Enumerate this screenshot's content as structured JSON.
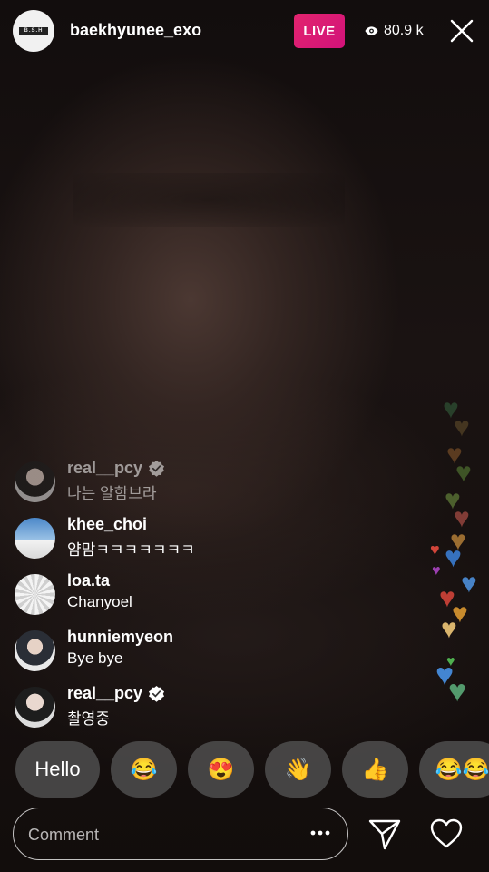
{
  "header": {
    "avatar_logo": "B.S.H",
    "username": "baekhyunee_exo",
    "live_label": "LIVE",
    "viewers": "80.9 k"
  },
  "comments": [
    {
      "user": "real__pcy",
      "text": "나는 알함브라",
      "verified": true
    },
    {
      "user": "khee_choi",
      "text": "얌맘ㅋㅋㅋㅋㅋㅋㅋ",
      "verified": false
    },
    {
      "user": "loa.ta",
      "text": "Chanyoel",
      "verified": false
    },
    {
      "user": "hunniemyeon",
      "text": "Bye bye",
      "verified": false
    },
    {
      "user": "real__pcy",
      "text": "촬영중",
      "verified": true
    }
  ],
  "quick_reactions": [
    "Hello",
    "😂",
    "😍",
    "👋",
    "👍",
    "😂😂"
  ],
  "composer": {
    "placeholder": "Comment"
  },
  "colors": {
    "live_badge": "#d81b74",
    "chip_bg": "#505050"
  },
  "icons": [
    "eye-icon",
    "close-icon",
    "verified-icon",
    "more-icon",
    "send-icon",
    "heart-icon"
  ]
}
